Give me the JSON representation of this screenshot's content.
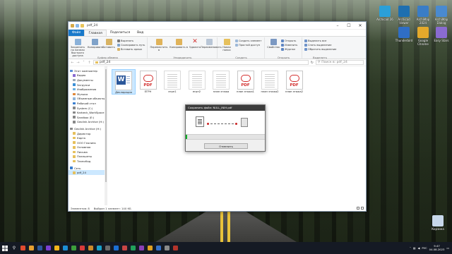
{
  "window": {
    "title": "pdf_24",
    "tabs": [
      "Файл",
      "Главная",
      "Поделиться",
      "Вид"
    ],
    "active_tab": "Главная"
  },
  "ribbon": {
    "pin_label": "Закрепить на панели быстрого доступа",
    "copy_label": "Копировать",
    "paste_label": "Вставить",
    "cut_label": "Вырезать",
    "copy_path_label": "Скопировать путь",
    "paste_shortcut_label": "Вставить ярлык",
    "clipboard_group": "Буфер обмена",
    "move_to_label": "Переместить в",
    "copy_to_label": "Копировать в",
    "delete_label": "Удалить",
    "rename_label": "Переименовать",
    "organize_group": "Упорядочить",
    "new_folder_label": "Новая папка",
    "new_item_label": "Создать элемент",
    "easy_access_label": "Простой доступ",
    "create_group": "Создать",
    "properties_label": "Свойства",
    "open_label": "Открыть",
    "edit_label": "Изменить",
    "history_label": "Журнал",
    "open_group": "Открыть",
    "select_all_label": "Выделить все",
    "select_none_label": "Снять выделение",
    "invert_label": "Обратить выделение",
    "select_group": "Выделить"
  },
  "address": {
    "path": "pdf_24",
    "search_placeholder": "Поиск в: pdf_24"
  },
  "nav": {
    "items": [
      "Этот компьютер",
      "Видео",
      "Документы",
      "Загрузки",
      "Изображения",
      "Музыка",
      "Объемные объекты",
      "Рабочий стол",
      "System (C:)",
      "Karbeck_WorkSpace",
      "Sandbox (E:)",
      "Geolink Archive (H:)",
      "Geolink Archive (H:)",
      "Директор",
      "Карта",
      "ООО Геолинк",
      "Основная",
      "Письма",
      "Планшеты",
      "ТехноКад",
      "Сеть",
      "pdf_24"
    ]
  },
  "files": [
    {
      "name": "Декларация",
      "kind": "word"
    },
    {
      "name": "ЕГРН",
      "kind": "pdf"
    },
    {
      "name": "егрп1",
      "kind": "doc"
    },
    {
      "name": "егрп2",
      "kind": "doc"
    },
    {
      "name": "план этажа",
      "kind": "doc"
    },
    {
      "name": "план этажа1",
      "kind": "pdf"
    },
    {
      "name": "план этажа2",
      "kind": "doc"
    },
    {
      "name": "план этажа2",
      "kind": "pdf"
    }
  ],
  "status": {
    "count": "Элементов: 8",
    "selection": "Выбран 1 элемент: 140 КБ"
  },
  "dialog": {
    "title": "Сохранить файл: NULL_INIH.pdf",
    "cancel_label": "Отменить",
    "progress": 0.02
  },
  "desktop_icons": [
    {
      "label": "Archicad 26",
      "color": "#2b9fd8"
    },
    {
      "label": "Archicad Viewer",
      "color": "#1e6fb0"
    },
    {
      "label": "ArchiMap 2024",
      "color": "#3a7dc6"
    },
    {
      "label": "ArchiMap Dialog",
      "color": "#4a8ad0"
    },
    {
      "label": "Thunderbird",
      "color": "#2f6ec5"
    },
    {
      "label": "Google Chrome",
      "color": "#e3a92b"
    },
    {
      "label": "Easy Stars",
      "color": "#8a6bd1"
    },
    {
      "label": "Корзина",
      "color": "#c7d7ea"
    }
  ],
  "taskbar": {
    "time": "9:47",
    "date": "04.08.2023",
    "lang": "РУС",
    "icons": [
      "#e04b2f",
      "#e8a030",
      "#2b579a",
      "#7a3fd1",
      "#f2b51b",
      "#1d8ed6",
      "#3c9e3c",
      "#d83a3a",
      "#cc8a2a",
      "#18a0c9",
      "#6a6a6a",
      "#1c6fd4",
      "#c74545",
      "#22a05b",
      "#8b3fb5",
      "#e0a020",
      "#3470c8",
      "#8a8a8a",
      "#b3342b"
    ]
  }
}
